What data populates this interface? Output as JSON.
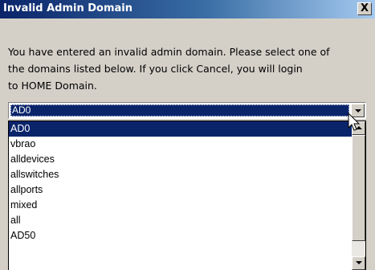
{
  "window": {
    "title": "Invalid Admin Domain",
    "close_glyph": "X"
  },
  "message": {
    "lines": [
      "You have entered an invalid admin domain. Please select one of",
      "the domains listed below. If you click Cancel, you will login",
      "to HOME Domain."
    ]
  },
  "domain_select": {
    "selected": "AD0",
    "options": [
      "AD0",
      "vbrao",
      "alldevices",
      "allswitches",
      "allports",
      "mixed",
      "all",
      "AD50"
    ],
    "highlighted_index": 0
  },
  "icons": {
    "combo_arrow": "chevron-down-icon",
    "scroll_up": "scroll-up-arrow-icon",
    "scroll_down": "scroll-down-arrow-icon",
    "cursor": "mouse-pointer-icon"
  },
  "colors": {
    "title_start": "#0a246a",
    "title_end": "#a6caf0",
    "selection": "#0a246a",
    "dialog_face": "#d4d0c8"
  }
}
